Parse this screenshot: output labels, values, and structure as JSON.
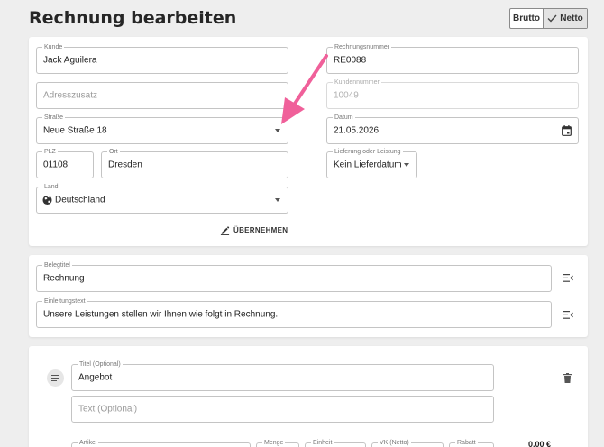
{
  "page": {
    "title": "Rechnung bearbeiten"
  },
  "toggle": {
    "brutto": "Brutto",
    "netto": "Netto"
  },
  "address": {
    "kunde": {
      "label": "Kunde",
      "value": "Jack Aguilera"
    },
    "adresszusatz": {
      "placeholder": "Adresszusatz"
    },
    "strasse": {
      "label": "Straße",
      "value": "Neue Straße 18"
    },
    "plz": {
      "label": "PLZ",
      "value": "01108"
    },
    "ort": {
      "label": "Ort",
      "value": "Dresden"
    },
    "land": {
      "label": "Land",
      "value": "Deutschland"
    },
    "uebernehmen_label": "ÜBERNEHMEN"
  },
  "invoice": {
    "rechnungsnummer": {
      "label": "Rechnungsnummer",
      "value": "RE0088"
    },
    "kundennummer": {
      "label": "Kundennummer",
      "value": "10049"
    },
    "datum": {
      "label": "Datum",
      "value": "21.05.2026"
    },
    "lieferung": {
      "label": "Lieferung oder Leistung",
      "value": "Kein Lieferdatum"
    }
  },
  "header_texts": {
    "belegtitel": {
      "label": "Belegtitel",
      "value": "Rechnung"
    },
    "einleitungstext": {
      "label": "Einleitungstext",
      "value": "Unsere Leistungen stellen wir Ihnen wie folgt in Rechnung."
    }
  },
  "position": {
    "titel": {
      "label": "Titel (Optional)",
      "value": "Angebot"
    },
    "text": {
      "placeholder": "Text (Optional)"
    },
    "columns": [
      "Artikel",
      "Menge",
      "Einheit",
      "VK (Netto)",
      "Rabatt"
    ],
    "price_partial": "0,00 €"
  },
  "colors": {
    "arrow": "#f0609a",
    "accent_bg": "#eeeeee"
  },
  "icons": [
    "check-icon",
    "caret-down-icon",
    "calendar-icon",
    "globe-icon",
    "pencil-icon",
    "text-options-icon",
    "drag-lines-icon",
    "trash-icon"
  ]
}
